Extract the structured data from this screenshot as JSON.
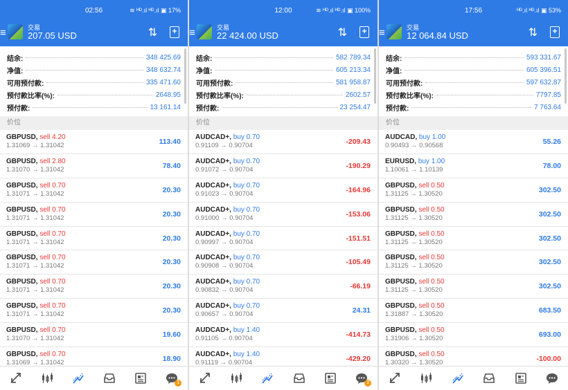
{
  "screens": [
    {
      "status": {
        "time": "02:56",
        "system": "≋ ᴴᴰ.ıl ᴴᴰ.ıl ▣ 17%"
      },
      "header": {
        "title": "交易",
        "balance": "207.05 USD"
      },
      "summary": [
        {
          "label": "结余:",
          "value": "348 425.69"
        },
        {
          "label": "净值:",
          "value": "348 632.74"
        },
        {
          "label": "可用预付款:",
          "value": "335 471.60"
        },
        {
          "label": "预付款比率(%):",
          "value": "2648.95"
        },
        {
          "label": "预付款:",
          "value": "13 161.14"
        }
      ],
      "section": "价位",
      "positions": [
        {
          "symbol": "GBPUSD,",
          "direction": "sell 4.20",
          "side": "sell",
          "prices": "1.31069 → 1.31042",
          "profit": "113.40",
          "sign": "pos"
        },
        {
          "symbol": "GBPUSD,",
          "direction": "sell 2.80",
          "side": "sell",
          "prices": "1.31070 → 1.31042",
          "profit": "78.40",
          "sign": "pos"
        },
        {
          "symbol": "GBPUSD,",
          "direction": "sell 0.70",
          "side": "sell",
          "prices": "1.31071 → 1.31042",
          "profit": "20.30",
          "sign": "pos"
        },
        {
          "symbol": "GBPUSD,",
          "direction": "sell 0.70",
          "side": "sell",
          "prices": "1.31071 → 1.31042",
          "profit": "20.30",
          "sign": "pos"
        },
        {
          "symbol": "GBPUSD,",
          "direction": "sell 0.70",
          "side": "sell",
          "prices": "1.31071 → 1.31042",
          "profit": "20.30",
          "sign": "pos"
        },
        {
          "symbol": "GBPUSD,",
          "direction": "sell 0.70",
          "side": "sell",
          "prices": "1.31071 → 1.31042",
          "profit": "20.30",
          "sign": "pos"
        },
        {
          "symbol": "GBPUSD,",
          "direction": "sell 0.70",
          "side": "sell",
          "prices": "1.31071 → 1.31042",
          "profit": "20.30",
          "sign": "pos"
        },
        {
          "symbol": "GBPUSD,",
          "direction": "sell 0.70",
          "side": "sell",
          "prices": "1.31071 → 1.31042",
          "profit": "20.30",
          "sign": "pos"
        },
        {
          "symbol": "GBPUSD,",
          "direction": "sell 0.70",
          "side": "sell",
          "prices": "1.31070 → 1.31042",
          "profit": "19.60",
          "sign": "pos"
        },
        {
          "symbol": "GBPUSD,",
          "direction": "sell 0.70",
          "side": "sell",
          "prices": "1.31069 → 1.31042",
          "profit": "18.90",
          "sign": "pos"
        }
      ],
      "badge": "1"
    },
    {
      "status": {
        "time": "12:00",
        "system": "≋ ᴴᴰ.ıl ᴴᴰ.ıl ▣ 100%"
      },
      "header": {
        "title": "交易",
        "balance": "22 424.00 USD"
      },
      "summary": [
        {
          "label": "结余:",
          "value": "582 789.34"
        },
        {
          "label": "净值:",
          "value": "605 213.34"
        },
        {
          "label": "可用预付款:",
          "value": "581 958.87"
        },
        {
          "label": "预付款比率(%):",
          "value": "2602.57"
        },
        {
          "label": "预付款:",
          "value": "23 254.47"
        }
      ],
      "section": "价位",
      "positions": [
        {
          "symbol": "AUDCAD+,",
          "direction": "buy 0.70",
          "side": "buy",
          "prices": "0.91109 → 0.90704",
          "profit": "-209.43",
          "sign": "neg"
        },
        {
          "symbol": "AUDCAD+,",
          "direction": "buy 0.70",
          "side": "buy",
          "prices": "0.91072 → 0.90704",
          "profit": "-190.29",
          "sign": "neg"
        },
        {
          "symbol": "AUDCAD+,",
          "direction": "buy 0.70",
          "side": "buy",
          "prices": "0.91023 → 0.90704",
          "profit": "-164.96",
          "sign": "neg"
        },
        {
          "symbol": "AUDCAD+,",
          "direction": "buy 0.70",
          "side": "buy",
          "prices": "0.91000 → 0.90704",
          "profit": "-153.06",
          "sign": "neg"
        },
        {
          "symbol": "AUDCAD+,",
          "direction": "buy 0.70",
          "side": "buy",
          "prices": "0.90997 → 0.90704",
          "profit": "-151.51",
          "sign": "neg"
        },
        {
          "symbol": "AUDCAD+,",
          "direction": "buy 0.70",
          "side": "buy",
          "prices": "0.90908 → 0.90704",
          "profit": "-105.49",
          "sign": "neg"
        },
        {
          "symbol": "AUDCAD+,",
          "direction": "buy 0.70",
          "side": "buy",
          "prices": "0.90832 → 0.90704",
          "profit": "-66.19",
          "sign": "neg"
        },
        {
          "symbol": "AUDCAD+,",
          "direction": "buy 0.70",
          "side": "buy",
          "prices": "0.90657 → 0.90704",
          "profit": "24.31",
          "sign": "pos"
        },
        {
          "symbol": "AUDCAD+,",
          "direction": "buy 1.40",
          "side": "buy",
          "prices": "0.91105 → 0.90704",
          "profit": "-414.73",
          "sign": "neg"
        },
        {
          "symbol": "AUDCAD+,",
          "direction": "buy 1.40",
          "side": "buy",
          "prices": "0.91119 → 0.90704",
          "profit": "-429.20",
          "sign": "neg"
        }
      ],
      "badge": "2"
    },
    {
      "status": {
        "time": "17:56",
        "system": "ᴴᴰ.ıl ᴴᴰ.ıl ▣ 53%"
      },
      "header": {
        "title": "交易",
        "balance": "12 064.84 USD"
      },
      "summary": [
        {
          "label": "结余:",
          "value": "593 331.67"
        },
        {
          "label": "净值:",
          "value": "605 396.51"
        },
        {
          "label": "可用预付款:",
          "value": "597 632.87"
        },
        {
          "label": "预付款比率(%):",
          "value": "7797.85"
        },
        {
          "label": "预付款:",
          "value": "7 763.64"
        }
      ],
      "section": "价位",
      "positions": [
        {
          "symbol": "AUDCAD,",
          "direction": "buy 1.00",
          "side": "buy",
          "prices": "0.90493 → 0.90568",
          "profit": "55.26",
          "sign": "pos"
        },
        {
          "symbol": "EURUSD,",
          "direction": "buy 1.00",
          "side": "buy",
          "prices": "1.10061 → 1.10139",
          "profit": "78.00",
          "sign": "pos"
        },
        {
          "symbol": "GBPUSD,",
          "direction": "sell 0.50",
          "side": "sell",
          "prices": "1.31125 → 1.30520",
          "profit": "302.50",
          "sign": "pos"
        },
        {
          "symbol": "GBPUSD,",
          "direction": "sell 0.50",
          "side": "sell",
          "prices": "1.31125 → 1.30520",
          "profit": "302.50",
          "sign": "pos"
        },
        {
          "symbol": "GBPUSD,",
          "direction": "sell 0.50",
          "side": "sell",
          "prices": "1.31125 → 1.30520",
          "profit": "302.50",
          "sign": "pos"
        },
        {
          "symbol": "GBPUSD,",
          "direction": "sell 0.50",
          "side": "sell",
          "prices": "1.31125 → 1.30520",
          "profit": "302.50",
          "sign": "pos"
        },
        {
          "symbol": "GBPUSD,",
          "direction": "sell 0.50",
          "side": "sell",
          "prices": "1.31125 → 1.30520",
          "profit": "302.50",
          "sign": "pos"
        },
        {
          "symbol": "GBPUSD,",
          "direction": "sell 0.50",
          "side": "sell",
          "prices": "1.31887 → 1.30520",
          "profit": "683.50",
          "sign": "pos"
        },
        {
          "symbol": "GBPUSD,",
          "direction": "sell 0.50",
          "side": "sell",
          "prices": "1.31906 → 1.30520",
          "profit": "693.00",
          "sign": "pos"
        },
        {
          "symbol": "GBPUSD,",
          "direction": "sell 0.50",
          "side": "sell",
          "prices": "1.30320 → 1.30520",
          "profit": "-100.00",
          "sign": "neg"
        }
      ],
      "badge": ""
    }
  ],
  "icons": {
    "menu": "hamburger-menu-icon",
    "logo": "app-logo-icon",
    "sort": "sort-arrows-icon",
    "add": "add-order-icon",
    "nav": [
      "quotes-icon",
      "chart-icon",
      "trade-icon",
      "history-icon",
      "news-icon",
      "messages-icon"
    ]
  },
  "colors": {
    "accent": "#2f7be6",
    "sell": "#e53935",
    "buy": "#2f7be6",
    "loss": "#e53935",
    "badge": "#f39c12"
  }
}
